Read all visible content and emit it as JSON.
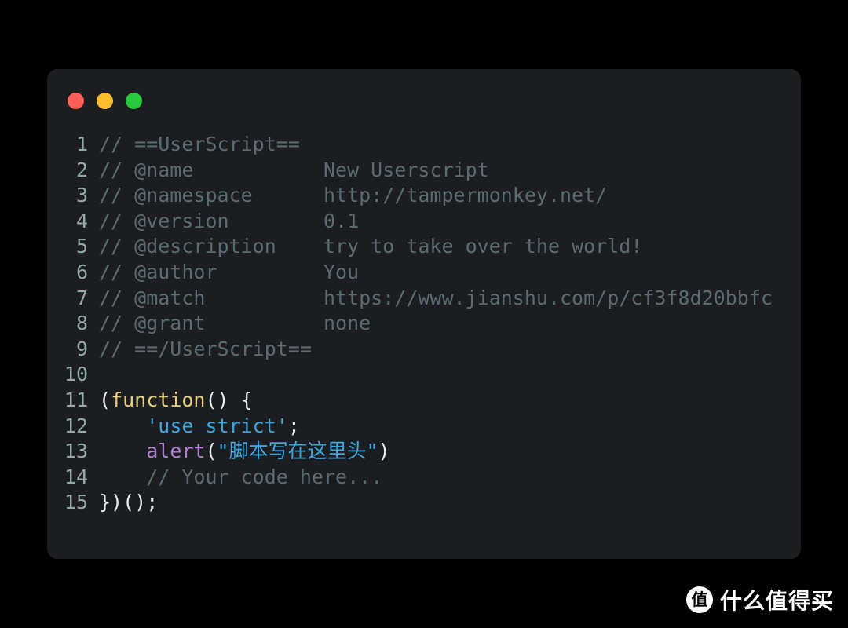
{
  "window": {
    "traffic_lights": [
      {
        "name": "close-button",
        "color": "#ff5f56"
      },
      {
        "name": "minimize-button",
        "color": "#ffbd2e"
      },
      {
        "name": "maximize-button",
        "color": "#27c93f"
      }
    ]
  },
  "editor": {
    "background": "#1b1d20",
    "page_background": "#000000",
    "line_number_color": "#93a9a3",
    "syntax_colors": {
      "comment": "#5a6b72",
      "keyword": "#e5cf7a",
      "string": "#3aa7e0",
      "function": "#b37fd4",
      "plain": "#e8eaed"
    },
    "lines": [
      {
        "n": "1",
        "tokens": [
          {
            "t": "comment",
            "v": "// ==UserScript=="
          }
        ]
      },
      {
        "n": "2",
        "tokens": [
          {
            "t": "comment",
            "v": "// @name           New Userscript"
          }
        ]
      },
      {
        "n": "3",
        "tokens": [
          {
            "t": "comment",
            "v": "// @namespace      http://tampermonkey.net/"
          }
        ]
      },
      {
        "n": "4",
        "tokens": [
          {
            "t": "comment",
            "v": "// @version        0.1"
          }
        ]
      },
      {
        "n": "5",
        "tokens": [
          {
            "t": "comment",
            "v": "// @description    try to take over the world!"
          }
        ]
      },
      {
        "n": "6",
        "tokens": [
          {
            "t": "comment",
            "v": "// @author         You"
          }
        ]
      },
      {
        "n": "7",
        "tokens": [
          {
            "t": "comment",
            "v": "// @match          https://www.jianshu.com/p/cf3f8d20bbfc"
          }
        ]
      },
      {
        "n": "8",
        "tokens": [
          {
            "t": "comment",
            "v": "// @grant          none"
          }
        ]
      },
      {
        "n": "9",
        "tokens": [
          {
            "t": "comment",
            "v": "// ==/UserScript=="
          }
        ]
      },
      {
        "n": "10",
        "tokens": []
      },
      {
        "n": "11",
        "tokens": [
          {
            "t": "plain",
            "v": "("
          },
          {
            "t": "keyword",
            "v": "function"
          },
          {
            "t": "plain",
            "v": "() {"
          }
        ]
      },
      {
        "n": "12",
        "tokens": [
          {
            "t": "plain",
            "v": "    "
          },
          {
            "t": "string",
            "v": "'use strict'"
          },
          {
            "t": "plain",
            "v": ";"
          }
        ]
      },
      {
        "n": "13",
        "tokens": [
          {
            "t": "plain",
            "v": "    "
          },
          {
            "t": "func",
            "v": "alert"
          },
          {
            "t": "plain",
            "v": "("
          },
          {
            "t": "string",
            "v": "\"脚本写在这里头\""
          },
          {
            "t": "plain",
            "v": ")"
          }
        ]
      },
      {
        "n": "14",
        "tokens": [
          {
            "t": "plain",
            "v": "    "
          },
          {
            "t": "comment",
            "v": "// Your code here..."
          }
        ]
      },
      {
        "n": "15",
        "tokens": [
          {
            "t": "plain",
            "v": "})();"
          }
        ]
      }
    ]
  },
  "watermark": {
    "logo_glyph": "值",
    "text": "什么值得买"
  }
}
